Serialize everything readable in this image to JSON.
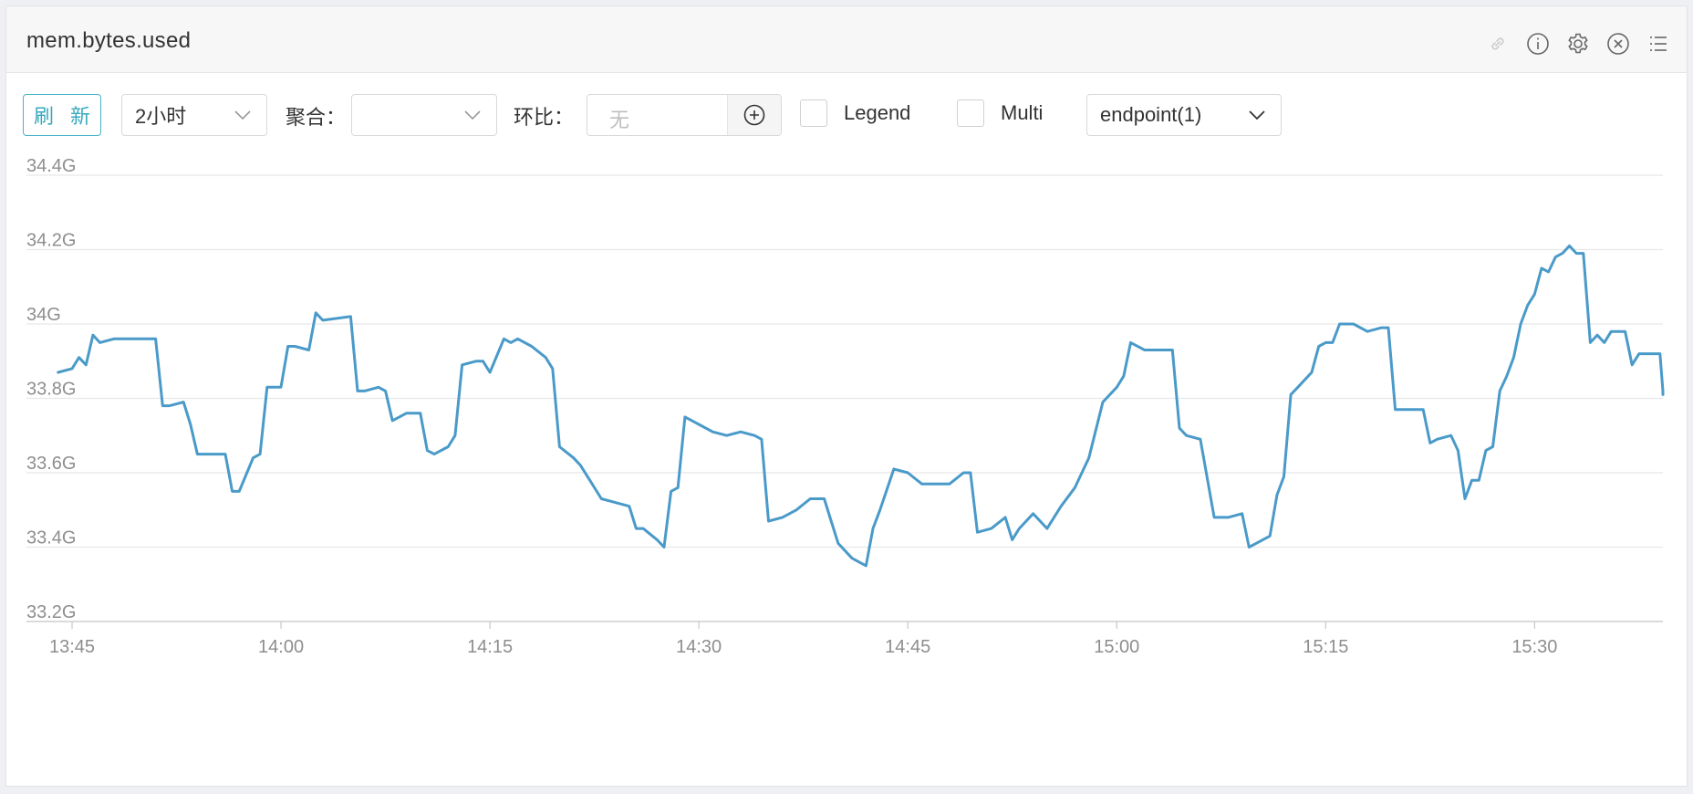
{
  "panel": {
    "title": "mem.bytes.used",
    "header_icons": [
      "link-icon",
      "info-icon",
      "gear-icon",
      "close-circle-icon",
      "list-icon"
    ]
  },
  "toolbar": {
    "refresh_label": "刷 新",
    "time_range": "2小时",
    "aggregate_label": "聚合：",
    "aggregate_value": "",
    "compare_label": "环比：",
    "compare_placeholder": "无",
    "legend_label": "Legend",
    "multi_label": "Multi",
    "endpoint_select": "endpoint(1)"
  },
  "colors": {
    "accent": "#3aa7bb",
    "series_line": "#4a9ac9",
    "grid": "#e8e8e8"
  },
  "chart_data": {
    "type": "line",
    "title": "",
    "xlabel": "",
    "ylabel": "",
    "ylim": [
      33.2,
      34.4
    ],
    "y_unit": "G",
    "y_ticks": [
      "34.4G",
      "34.2G",
      "34G",
      "33.8G",
      "33.6G",
      "33.4G",
      "33.2G"
    ],
    "x_ticks": [
      "13:45",
      "14:00",
      "14:15",
      "14:30",
      "14:45",
      "15:00",
      "15:15",
      "15:30"
    ],
    "legend": false,
    "grid": true,
    "series": [
      {
        "points": [
          [
            "13:44",
            33.87
          ],
          [
            "13:45",
            33.88
          ],
          [
            "13:45:30",
            33.91
          ],
          [
            "13:46",
            33.89
          ],
          [
            "13:46:30",
            33.97
          ],
          [
            "13:47",
            33.95
          ],
          [
            "13:48",
            33.96
          ],
          [
            "13:50",
            33.96
          ],
          [
            "13:51",
            33.96
          ],
          [
            "13:51:30",
            33.78
          ],
          [
            "13:52",
            33.78
          ],
          [
            "13:53",
            33.79
          ],
          [
            "13:53:30",
            33.73
          ],
          [
            "13:54",
            33.65
          ],
          [
            "13:56",
            33.65
          ],
          [
            "13:56:30",
            33.55
          ],
          [
            "13:57",
            33.55
          ],
          [
            "13:58",
            33.64
          ],
          [
            "13:58:30",
            33.65
          ],
          [
            "13:59",
            33.83
          ],
          [
            "14:00",
            33.83
          ],
          [
            "14:00:30",
            33.94
          ],
          [
            "14:01",
            33.94
          ],
          [
            "14:02",
            33.93
          ],
          [
            "14:02:30",
            34.03
          ],
          [
            "14:03",
            34.01
          ],
          [
            "14:05",
            34.02
          ],
          [
            "14:05:30",
            33.82
          ],
          [
            "14:06",
            33.82
          ],
          [
            "14:07",
            33.83
          ],
          [
            "14:07:30",
            33.82
          ],
          [
            "14:08",
            33.74
          ],
          [
            "14:09",
            33.76
          ],
          [
            "14:10",
            33.76
          ],
          [
            "14:10:30",
            33.66
          ],
          [
            "14:11",
            33.65
          ],
          [
            "14:12",
            33.67
          ],
          [
            "14:12:30",
            33.7
          ],
          [
            "14:13",
            33.89
          ],
          [
            "14:14",
            33.9
          ],
          [
            "14:14:30",
            33.9
          ],
          [
            "14:15",
            33.87
          ],
          [
            "14:16",
            33.96
          ],
          [
            "14:16:30",
            33.95
          ],
          [
            "14:17",
            33.96
          ],
          [
            "14:18",
            33.94
          ],
          [
            "14:19",
            33.91
          ],
          [
            "14:19:30",
            33.88
          ],
          [
            "14:20",
            33.67
          ],
          [
            "14:21",
            33.64
          ],
          [
            "14:21:30",
            33.62
          ],
          [
            "14:22",
            33.59
          ],
          [
            "14:23",
            33.53
          ],
          [
            "14:24",
            33.52
          ],
          [
            "14:25",
            33.51
          ],
          [
            "14:25:30",
            33.45
          ],
          [
            "14:26",
            33.45
          ],
          [
            "14:27",
            33.42
          ],
          [
            "14:27:30",
            33.4
          ],
          [
            "14:28",
            33.55
          ],
          [
            "14:28:30",
            33.56
          ],
          [
            "14:29",
            33.75
          ],
          [
            "14:30",
            33.73
          ],
          [
            "14:31",
            33.71
          ],
          [
            "14:32",
            33.7
          ],
          [
            "14:33",
            33.71
          ],
          [
            "14:34",
            33.7
          ],
          [
            "14:34:30",
            33.69
          ],
          [
            "14:35",
            33.47
          ],
          [
            "14:36",
            33.48
          ],
          [
            "14:37",
            33.5
          ],
          [
            "14:38",
            33.53
          ],
          [
            "14:39",
            33.53
          ],
          [
            "14:39:30",
            33.47
          ],
          [
            "14:40",
            33.41
          ],
          [
            "14:41",
            33.37
          ],
          [
            "14:42",
            33.35
          ],
          [
            "14:42:30",
            33.45
          ],
          [
            "14:43",
            33.5
          ],
          [
            "14:44",
            33.61
          ],
          [
            "14:45",
            33.6
          ],
          [
            "14:46",
            33.57
          ],
          [
            "14:47",
            33.57
          ],
          [
            "14:48",
            33.57
          ],
          [
            "14:49",
            33.6
          ],
          [
            "14:49:30",
            33.6
          ],
          [
            "14:50",
            33.44
          ],
          [
            "14:51",
            33.45
          ],
          [
            "14:52",
            33.48
          ],
          [
            "14:52:30",
            33.42
          ],
          [
            "14:53",
            33.45
          ],
          [
            "14:54",
            33.49
          ],
          [
            "14:55",
            33.45
          ],
          [
            "14:56",
            33.51
          ],
          [
            "14:57",
            33.56
          ],
          [
            "14:58",
            33.64
          ],
          [
            "14:59",
            33.79
          ],
          [
            "15:00",
            33.83
          ],
          [
            "15:00:30",
            33.86
          ],
          [
            "15:01",
            33.95
          ],
          [
            "15:02",
            33.93
          ],
          [
            "15:04",
            33.93
          ],
          [
            "15:04:30",
            33.72
          ],
          [
            "15:05",
            33.7
          ],
          [
            "15:06",
            33.69
          ],
          [
            "15:07",
            33.48
          ],
          [
            "15:08",
            33.48
          ],
          [
            "15:09",
            33.49
          ],
          [
            "15:09:30",
            33.4
          ],
          [
            "15:10",
            33.41
          ],
          [
            "15:11",
            33.43
          ],
          [
            "15:11:30",
            33.54
          ],
          [
            "15:12",
            33.59
          ],
          [
            "15:12:30",
            33.81
          ],
          [
            "15:13",
            33.83
          ],
          [
            "15:14",
            33.87
          ],
          [
            "15:14:30",
            33.94
          ],
          [
            "15:15",
            33.95
          ],
          [
            "15:15:30",
            33.95
          ],
          [
            "15:16",
            34.0
          ],
          [
            "15:17",
            34.0
          ],
          [
            "15:18",
            33.98
          ],
          [
            "15:19",
            33.99
          ],
          [
            "15:19:30",
            33.99
          ],
          [
            "15:20",
            33.77
          ],
          [
            "15:21",
            33.77
          ],
          [
            "15:22",
            33.77
          ],
          [
            "15:22:30",
            33.68
          ],
          [
            "15:23",
            33.69
          ],
          [
            "15:24",
            33.7
          ],
          [
            "15:24:30",
            33.66
          ],
          [
            "15:25",
            33.53
          ],
          [
            "15:25:30",
            33.58
          ],
          [
            "15:26",
            33.58
          ],
          [
            "15:26:30",
            33.66
          ],
          [
            "15:27",
            33.67
          ],
          [
            "15:27:30",
            33.82
          ],
          [
            "15:28",
            33.86
          ],
          [
            "15:28:30",
            33.91
          ],
          [
            "15:29",
            34.0
          ],
          [
            "15:29:30",
            34.05
          ],
          [
            "15:30",
            34.08
          ],
          [
            "15:30:30",
            34.15
          ],
          [
            "15:31",
            34.14
          ],
          [
            "15:31:30",
            34.18
          ],
          [
            "15:32",
            34.19
          ],
          [
            "15:32:30",
            34.21
          ],
          [
            "15:33",
            34.19
          ],
          [
            "15:33:30",
            34.19
          ],
          [
            "15:34",
            33.95
          ],
          [
            "15:34:30",
            33.97
          ],
          [
            "15:35",
            33.95
          ],
          [
            "15:35:30",
            33.98
          ],
          [
            "15:36",
            33.98
          ],
          [
            "15:36:30",
            33.98
          ],
          [
            "15:37",
            33.89
          ],
          [
            "15:37:30",
            33.92
          ],
          [
            "15:38",
            33.92
          ],
          [
            "15:39",
            33.92
          ],
          [
            "15:39:30",
            33.82
          ],
          [
            "15:40",
            33.81
          ],
          [
            "15:40:30",
            33.82
          ]
        ]
      }
    ]
  }
}
